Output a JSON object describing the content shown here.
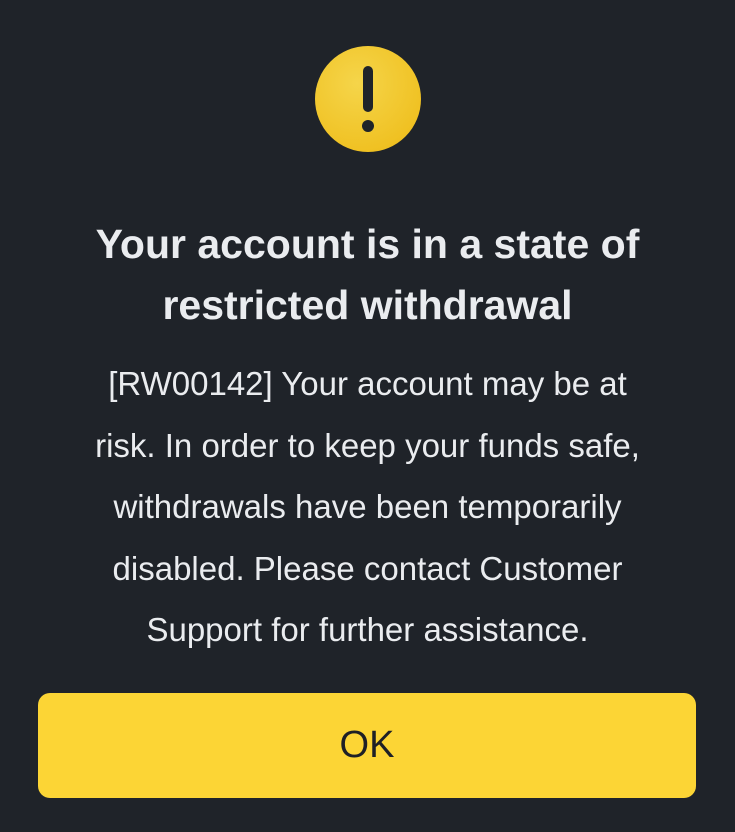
{
  "dialog": {
    "icon": "warning-exclamation-icon",
    "accent_color": "#F0C224",
    "title": "Your account is in a state of\nrestricted withdrawal",
    "message": "[RW00142] Your account may be at\nrisk. In order to keep your funds safe,\nwithdrawals have been temporarily\ndisabled. Please contact Customer\nSupport for further assistance.",
    "ok_label": "OK",
    "button_color": "#FCD535",
    "background_color": "#1F2329"
  }
}
